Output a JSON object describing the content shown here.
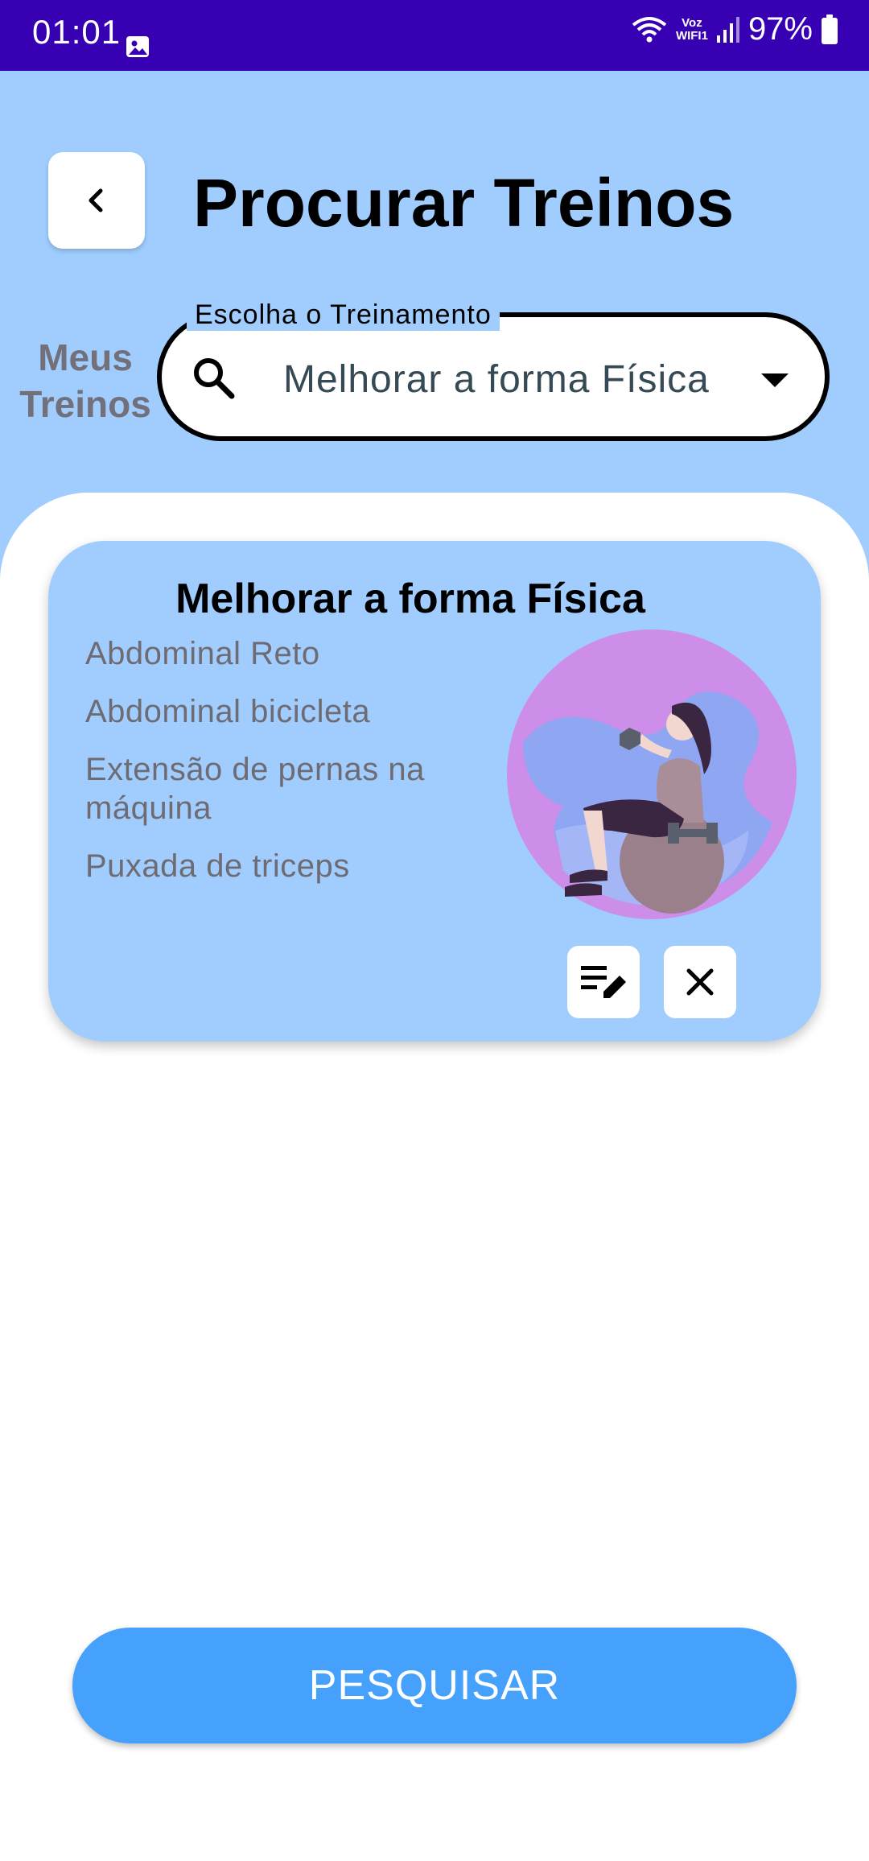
{
  "status_bar": {
    "time": "01:01",
    "network_label_top": "Voz",
    "network_label_bottom": "WIFI1",
    "battery": "97%",
    "icons": [
      "gallery-icon",
      "wifi-icon",
      "signal-icon",
      "battery-icon"
    ]
  },
  "header": {
    "back_icon": "chevron-left-icon",
    "title": "Procurar Treinos"
  },
  "side_label": {
    "line1": "Meus",
    "line2": "Treinos"
  },
  "search": {
    "label": "Escolha o Treinamento",
    "value": "Melhorar a forma Física",
    "icon": "search-icon",
    "dropdown_icon": "caret-down-icon"
  },
  "card": {
    "title": "Melhorar a forma Física",
    "exercises": [
      "Abdominal Reto",
      "Abdominal bicicleta",
      "Extensão de pernas na máquina",
      "Puxada de triceps"
    ],
    "edit_icon": "edit-list-icon",
    "delete_icon": "close-icon"
  },
  "footer": {
    "search_button": "PESQUISAR"
  },
  "colors": {
    "status_bar": "#3700b3",
    "background": "#a0cdfe",
    "button": "#45a1fc",
    "illustration_circle": "#cc8ee8"
  }
}
